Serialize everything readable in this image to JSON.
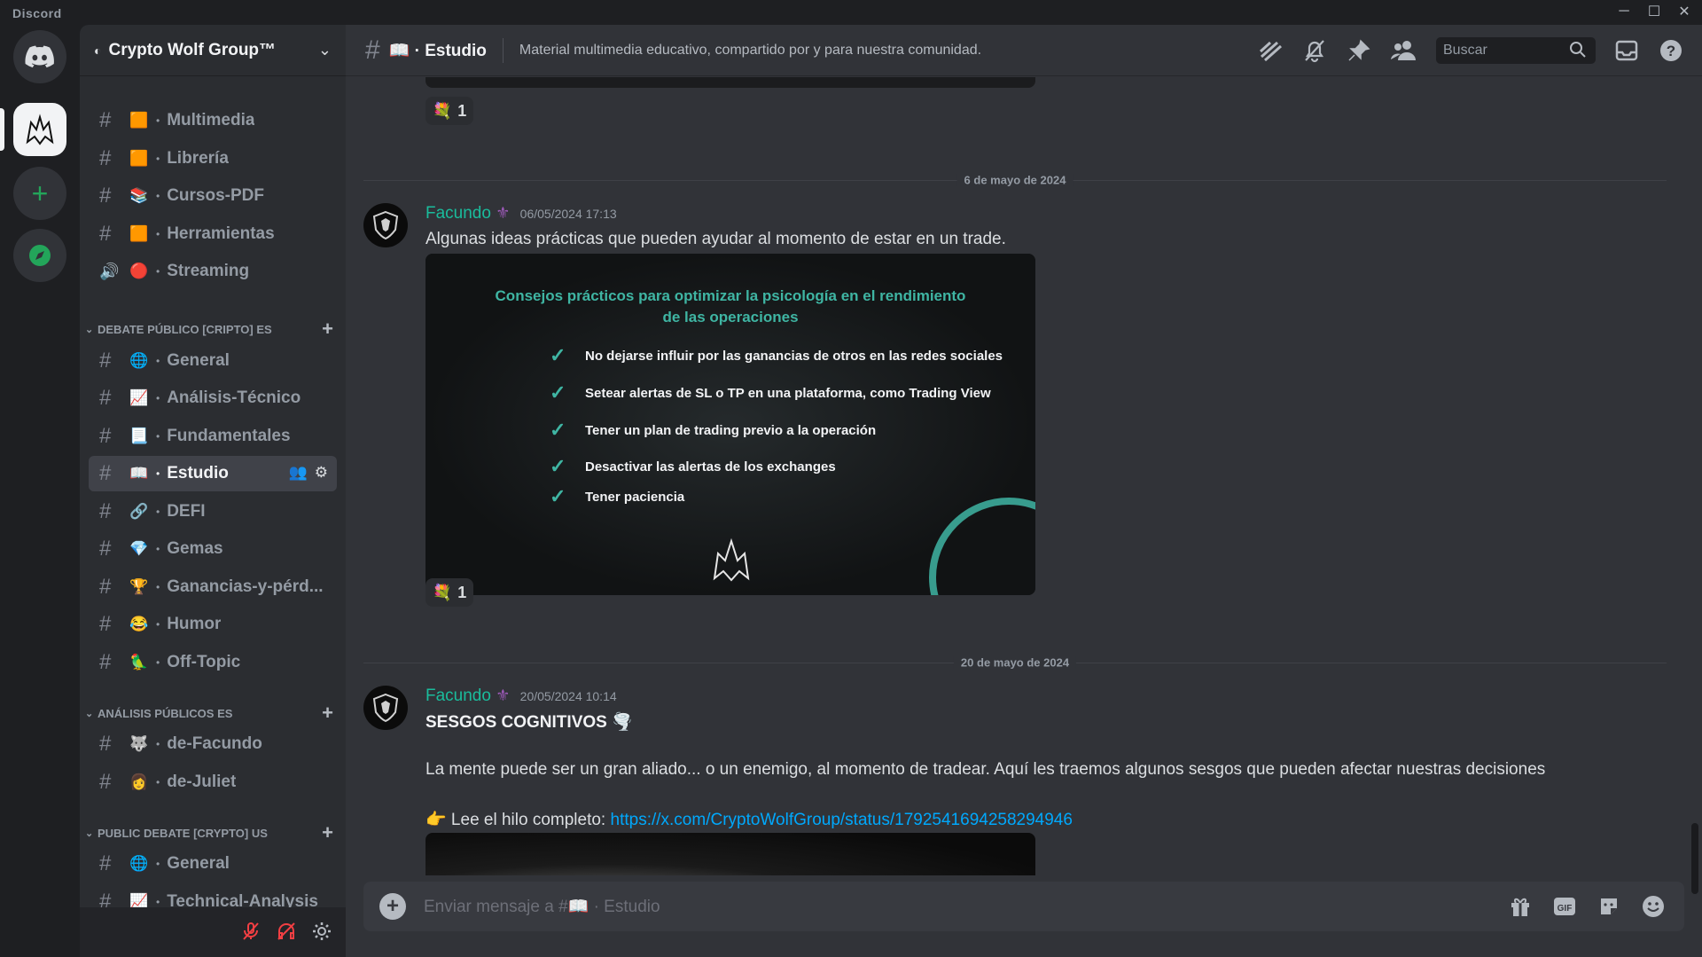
{
  "app": {
    "title": "Discord"
  },
  "server": {
    "name": "Crypto Wolf Group™"
  },
  "sidebar": {
    "channels_top": [
      {
        "emoji": "🟧",
        "name": "Multimedia"
      },
      {
        "emoji": "🟧",
        "name": "Librería"
      },
      {
        "emoji": "📚",
        "name": "Cursos-PDF"
      },
      {
        "emoji": "🟧",
        "name": "Herramientas"
      },
      {
        "emoji": "🔴",
        "name": "Streaming"
      }
    ],
    "cat_debate": "DEBATE PÚBLICO [CRIPTO] ES",
    "channels_debate": [
      {
        "emoji": "🌐",
        "name": "General"
      },
      {
        "emoji": "📈",
        "name": "Análisis-Técnico"
      },
      {
        "emoji": "📃",
        "name": "Fundamentales"
      },
      {
        "emoji": "📖",
        "name": "Estudio"
      },
      {
        "emoji": "🔗",
        "name": "DEFI"
      },
      {
        "emoji": "💎",
        "name": "Gemas"
      },
      {
        "emoji": "🏆",
        "name": "Ganancias-y-pérd..."
      },
      {
        "emoji": "😂",
        "name": "Humor"
      },
      {
        "emoji": "🦜",
        "name": "Off-Topic"
      }
    ],
    "cat_analisis": "ANÁLISIS PÚBLICOS ES",
    "channels_analisis": [
      {
        "emoji": "🐺",
        "name": "de-Facundo"
      },
      {
        "emoji": "👩",
        "name": "de-Juliet"
      }
    ],
    "cat_public": "PUBLIC DEBATE [CRYPTO] US",
    "channels_public": [
      {
        "emoji": "🌐",
        "name": "General"
      },
      {
        "emoji": "📈",
        "name": "Technical-Analysis"
      }
    ]
  },
  "header": {
    "channel": "📖 · Estudio",
    "topic": "Material multimedia educativo, compartido por y para nuestra comunidad.",
    "search_placeholder": "Buscar"
  },
  "messages": {
    "reaction_top": "1",
    "date1": "6 de mayo de 2024",
    "m1_author": "Facundo",
    "m1_time": "06/05/2024 17:13",
    "m1_text": "Algunas ideas prácticas que pueden ayudar al momento de estar en un trade.",
    "img_title_1": "Consejos prácticos para optimizar la psicología en el rendimiento",
    "img_title_2": "de las operaciones",
    "tips": [
      "No dejarse influir por las ganancias de otros en las redes sociales",
      "Setear alertas de SL o TP en una plataforma, como Trading View",
      "Tener un plan de trading previo a la operación",
      "Desactivar las alertas de los exchanges",
      "Tener paciencia"
    ],
    "reaction_m1": "1",
    "date2": "20 de mayo de 2024",
    "m2_author": "Facundo",
    "m2_time": "20/05/2024 10:14",
    "m2_title": "SESGOS COGNITIVOS 🌪️",
    "m2_text": "La mente puede ser un gran aliado... o un enemigo, al momento de tradear. Aquí les traemos algunos sesgos que pueden afectar nuestras decisiones",
    "m2_lee": "👉 Lee el hilo completo: ",
    "m2_link": "https://x.com/CryptoWolfGroup/status/1792541694258294946"
  },
  "composer": {
    "placeholder": "Enviar mensaje a #📖 · Estudio"
  },
  "colors": {
    "accent": "#1abc9c",
    "link": "#00a8fc",
    "active": "#404249"
  }
}
